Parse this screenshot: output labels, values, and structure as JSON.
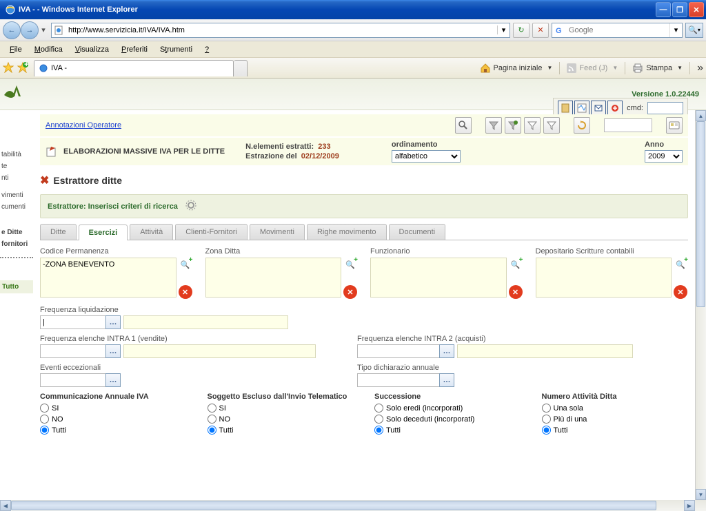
{
  "window": {
    "title": "IVA - - Windows Internet Explorer"
  },
  "nav": {
    "url": "http://www.servizicia.it/IVA/IVA.htm",
    "search_placeholder": "Google"
  },
  "menubar": [
    "File",
    "Modifica",
    "Visualizza",
    "Preferiti",
    "Strumenti",
    "?"
  ],
  "browser_tab": "IVA -",
  "toolbar": {
    "home": "Pagina iniziale",
    "feed": "Feed (J)",
    "print": "Stampa"
  },
  "app": {
    "version": "Versione 1.0.22449",
    "cmd_label": "cmd:"
  },
  "leftnav": {
    "items": [
      "tabilità",
      "te",
      "nti",
      "vimenti",
      "cumenti"
    ],
    "bold1": "e Ditte",
    "bold2": "fornitori",
    "green": "Tutto"
  },
  "annot": {
    "link": "Annotazioni Operatore"
  },
  "info": {
    "title": "ELABORAZIONI MASSIVE IVA PER LE DITTE",
    "n_elem_label": "N.elementi estratti:",
    "n_elem_value": "233",
    "estr_label": "Estrazione del",
    "estr_value": "02/12/2009",
    "ord_label": "ordinamento",
    "ord_value": "alfabetico",
    "anno_label": "Anno",
    "anno_value": "2009"
  },
  "section": {
    "title": "Estrattore ditte",
    "subtitle": "Estrattore: Inserisci criteri di ricerca"
  },
  "tabs": [
    "Ditte",
    "Esercizi",
    "Attività",
    "Clienti-Fornitori",
    "Movimenti",
    "Righe movimento",
    "Documenti"
  ],
  "active_tab": 1,
  "criteria": {
    "labels": [
      "Codice Permanenza",
      "Zona Ditta",
      "Funzionario",
      "Depositario Scritture contabili"
    ],
    "values": [
      "-ZONA BENEVENTO",
      "",
      "",
      ""
    ]
  },
  "form": {
    "freq_liq": "Frequenza liquidazione",
    "freq_liq_value": "|",
    "freq_intra1": "Frequenza elenche INTRA 1 (vendite)",
    "freq_intra2": "Frequenza elenche INTRA 2 (acquisti)",
    "eventi": "Eventi eccezionali",
    "tipo_dich": "Tipo dichiarazio annuale"
  },
  "radios": {
    "g1": {
      "title": "Communicazione Annuale IVA",
      "opts": [
        "SI",
        "NO",
        "Tutti"
      ],
      "sel": 2
    },
    "g2": {
      "title": "Soggetto Escluso dall'Invio Telematico",
      "opts": [
        "SI",
        "NO",
        "Tutti"
      ],
      "sel": 2
    },
    "g3": {
      "title": "Successione",
      "opts": [
        "Solo eredi (incorporati)",
        "Solo deceduti (incorporati)",
        "Tutti"
      ],
      "sel": 2
    },
    "g4": {
      "title": "Numero Attività Ditta",
      "opts": [
        "Una sola",
        "Più di una",
        "Tutti"
      ],
      "sel": 2
    }
  }
}
